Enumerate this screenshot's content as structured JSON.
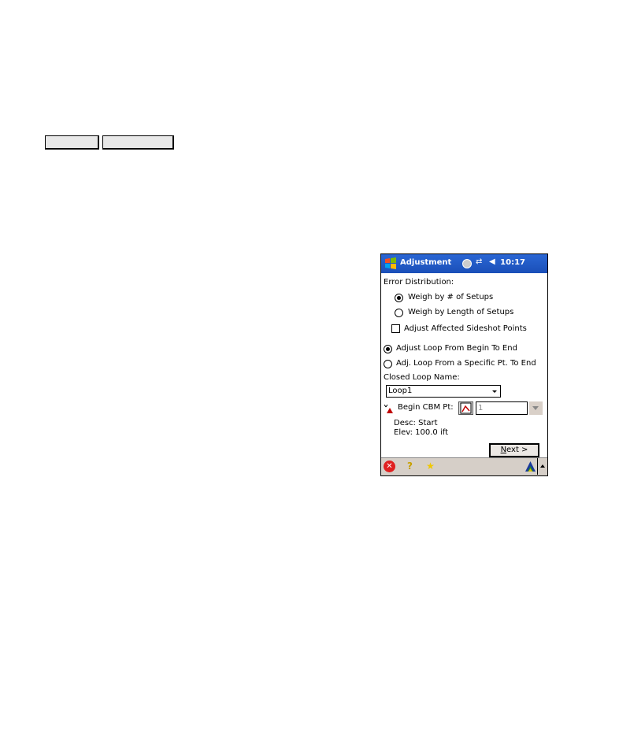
{
  "top_tabs": [
    "",
    ""
  ],
  "titlebar": {
    "app_icon": "windows-start-flag-icon",
    "title": "Adjustment",
    "status_icons": [
      "sync-icon",
      "connectivity-icon",
      "speaker-icon"
    ],
    "clock": "10:17"
  },
  "error_distribution": {
    "label": "Error Distribution:",
    "options": [
      {
        "label": "Weigh by # of Setups",
        "selected": true
      },
      {
        "label": "Weigh by Length of Setups",
        "selected": false
      }
    ],
    "adjust_sideshots": {
      "label": "Adjust Affected Sideshot Points",
      "checked": false
    }
  },
  "loop_mode": {
    "options": [
      {
        "label": "Adjust Loop From Begin To End",
        "selected": true
      },
      {
        "label": "Adj. Loop From a Specific Pt. To End",
        "selected": false
      }
    ]
  },
  "closed_loop": {
    "label": "Closed Loop Name:",
    "value": "Loop1"
  },
  "begin_cbm": {
    "label": "Begin CBM Pt:",
    "value": "1",
    "desc": "Desc: Start",
    "elev": "Elev: 100.0 ift"
  },
  "next_button": {
    "accel": "N",
    "rest": "ext >"
  },
  "bottombar": {
    "icons": [
      "close-icon",
      "help-icon",
      "favorites-star-icon",
      "carlson-logo-icon",
      "scroll-up-icon"
    ]
  }
}
